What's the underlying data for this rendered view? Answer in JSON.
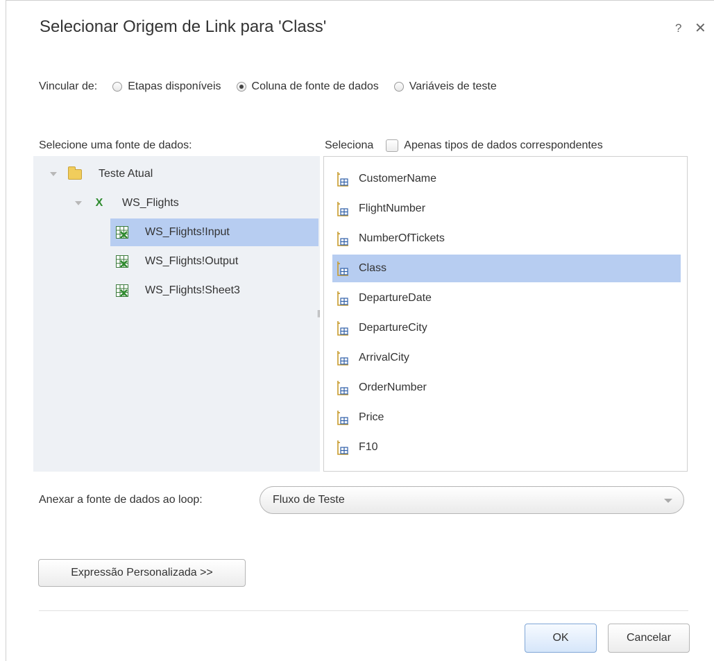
{
  "dialog": {
    "title": "Selecionar Origem de Link para 'Class'",
    "help": "?",
    "close": "✕"
  },
  "link_from": {
    "label": "Vincular de:",
    "options": [
      {
        "label": "Etapas disponíveis",
        "selected": false
      },
      {
        "label": "Coluna de fonte de dados",
        "selected": true
      },
      {
        "label": "Variáveis de teste",
        "selected": false
      }
    ]
  },
  "source_label": "Selecione uma fonte de dados:",
  "column_header": {
    "label": "Seleciona",
    "checkbox_label": "Apenas tipos de dados correspondentes",
    "checked": false
  },
  "tree": [
    {
      "label": "Teste Atual",
      "icon": "folder-icon",
      "level": 0,
      "expanded": true
    },
    {
      "label": "WS_Flights",
      "icon": "excel-icon",
      "level": 1,
      "expanded": true
    },
    {
      "label": "WS_Flights!Input",
      "icon": "sheet-icon",
      "level": 2,
      "selected": true
    },
    {
      "label": "WS_Flights!Output",
      "icon": "sheet-icon",
      "level": 2
    },
    {
      "label": "WS_Flights!Sheet3",
      "icon": "sheet-icon",
      "level": 2
    }
  ],
  "columns": [
    {
      "label": "CustomerName"
    },
    {
      "label": "FlightNumber"
    },
    {
      "label": "NumberOfTickets"
    },
    {
      "label": "Class",
      "selected": true
    },
    {
      "label": "DepartureDate"
    },
    {
      "label": "DepartureCity"
    },
    {
      "label": "ArrivalCity"
    },
    {
      "label": "OrderNumber"
    },
    {
      "label": "Price"
    },
    {
      "label": "F10"
    }
  ],
  "loop": {
    "label": "Anexar a fonte de dados ao loop:",
    "value": "Fluxo de Teste"
  },
  "buttons": {
    "custom_expression": "Expressão Personalizada >>",
    "ok": "OK",
    "cancel": "Cancelar"
  },
  "colors": {
    "selection": "#b7cdf1",
    "tree_background": "#eef1f5",
    "excel_green": "#2e8b2e"
  }
}
